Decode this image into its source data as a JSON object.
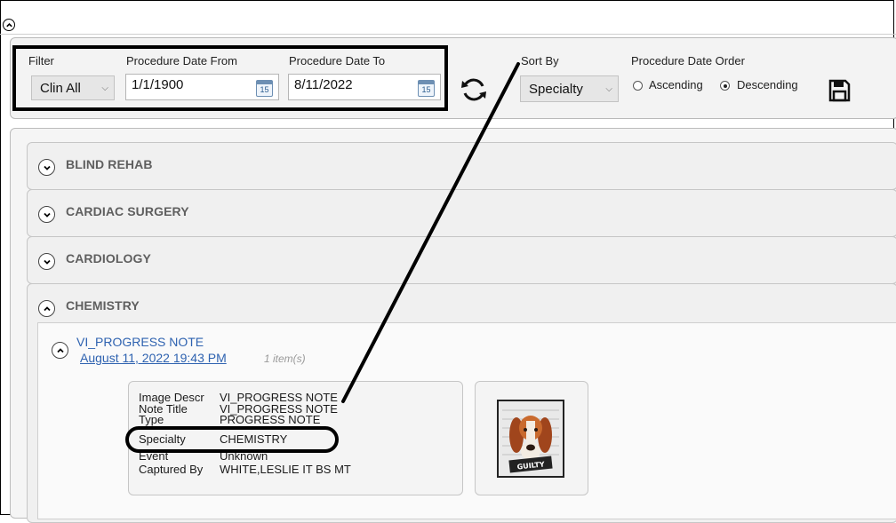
{
  "filter": {
    "label": "Filter",
    "value": "Clin All",
    "date_from_label": "Procedure Date From",
    "date_from": "1/1/1900",
    "date_to_label": "Procedure Date To",
    "date_to": "8/11/2022",
    "calendar_day": "15"
  },
  "sort": {
    "label": "Sort By",
    "value": "Specialty",
    "order_label": "Procedure Date Order",
    "ascending_label": "Ascending",
    "descending_label": "Descending",
    "selected": "Descending"
  },
  "groups": [
    {
      "title": "BLIND REHAB",
      "expanded": false
    },
    {
      "title": "CARDIAC SURGERY",
      "expanded": false
    },
    {
      "title": "CARDIOLOGY",
      "expanded": false
    },
    {
      "title": "CHEMISTRY",
      "expanded": true
    }
  ],
  "note": {
    "title": "VI_PROGRESS NOTE",
    "date": "August 11, 2022 19:43 PM",
    "count": "1 item(s)",
    "fields": [
      {
        "key": "Image Descr",
        "value": "VI_PROGRESS NOTE"
      },
      {
        "key": "Note Title",
        "value": "VI_PROGRESS NOTE"
      },
      {
        "key": "Type",
        "value": "PROGRESS NOTE"
      },
      {
        "key": "Specialty",
        "value": "CHEMISTRY"
      },
      {
        "key": "Event",
        "value": "Unknown"
      },
      {
        "key": "Captured By",
        "value": "WHITE,LESLIE IT BS MT"
      }
    ],
    "thumbnail_text": "GUILTY"
  },
  "colors": {
    "link": "#2e62b0",
    "group_text": "#5f5f5f",
    "panel_bg": "#f3f3f3"
  }
}
